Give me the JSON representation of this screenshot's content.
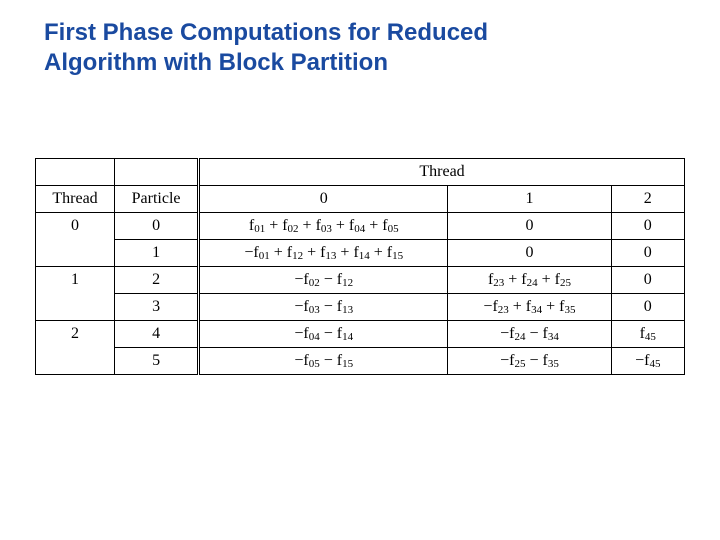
{
  "title_line1": "First Phase Computations for Reduced",
  "title_line2": "Algorithm with Block Partition",
  "hdr": {
    "thread": "Thread",
    "particle": "Particle",
    "thread_group": "Thread",
    "t0": "0",
    "t1": "1",
    "t2": "2"
  },
  "rows": [
    {
      "th": "0",
      "p": "0",
      "c0": "f<sub>01</sub> + f<sub>02</sub> + f<sub>03</sub> + f<sub>04</sub> + f<sub>05</sub>",
      "c1": "0",
      "c2": "0"
    },
    {
      "th": "",
      "p": "1",
      "c0": "−f<sub>01</sub> + f<sub>12</sub> + f<sub>13</sub> + f<sub>14</sub> + f<sub>15</sub>",
      "c1": "0",
      "c2": "0"
    },
    {
      "th": "1",
      "p": "2",
      "c0": "−f<sub>02</sub> − f<sub>12</sub>",
      "c1": "f<sub>23</sub> + f<sub>24</sub> + f<sub>25</sub>",
      "c2": "0"
    },
    {
      "th": "",
      "p": "3",
      "c0": "−f<sub>03</sub> − f<sub>13</sub>",
      "c1": "−f<sub>23</sub> + f<sub>34</sub> + f<sub>35</sub>",
      "c2": "0"
    },
    {
      "th": "2",
      "p": "4",
      "c0": "−f<sub>04</sub> − f<sub>14</sub>",
      "c1": "−f<sub>24</sub> − f<sub>34</sub>",
      "c2": "f<sub>45</sub>"
    },
    {
      "th": "",
      "p": "5",
      "c0": "−f<sub>05</sub> − f<sub>15</sub>",
      "c1": "−f<sub>25</sub> − f<sub>35</sub>",
      "c2": "−f<sub>45</sub>"
    }
  ],
  "chart_data": {
    "type": "table",
    "title": "First Phase Computations for Reduced Algorithm with Block Partition",
    "columns": [
      "Thread",
      "Particle",
      "Thread 0",
      "Thread 1",
      "Thread 2"
    ],
    "rows": [
      [
        "0",
        "0",
        "f01 + f02 + f03 + f04 + f05",
        "0",
        "0"
      ],
      [
        "0",
        "1",
        "-f01 + f12 + f13 + f14 + f15",
        "0",
        "0"
      ],
      [
        "1",
        "2",
        "-f02 - f12",
        "f23 + f24 + f25",
        "0"
      ],
      [
        "1",
        "3",
        "-f03 - f13",
        "-f23 + f34 + f35",
        "0"
      ],
      [
        "2",
        "4",
        "-f04 - f14",
        "-f24 - f34",
        "f45"
      ],
      [
        "2",
        "5",
        "-f05 - f15",
        "-f25 - f35",
        "-f45"
      ]
    ]
  }
}
